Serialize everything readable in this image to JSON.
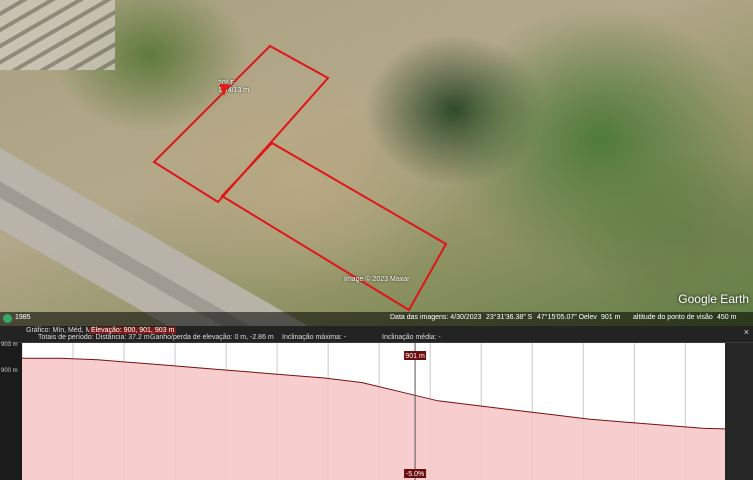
{
  "map": {
    "placemark_label_line1": "20º F",
    "placemark_label_line2": "13/4/13 m",
    "imagery_credit": "Image © 2023 Maxar",
    "logo": "Google Earth",
    "lot_color": "#e01515"
  },
  "status_bar": {
    "year": "1985",
    "imagery_date": "Data das imagens: 4/30/2023",
    "lat": "23°31'36.38\" S",
    "lon": "47°15'05.07\" O",
    "elev_label": "elev",
    "elev_value": "901 m",
    "eye_alt_label": "altitude do ponto de visão",
    "eye_alt_value": "450 m"
  },
  "profile": {
    "header": {
      "graph_label": "Gráfico: Mín, Méd, Máx:",
      "elevation_label": "Elevação: 900, 901, 903 m",
      "range_totals": "Totais de período: Distância: 37.2 m",
      "gain_loss": "Ganho/perda de elevação: 0 m, -2.86 m",
      "max_slope": "Inclinação máxima: -",
      "avg_slope": "Inclinação média: -"
    },
    "cursor_elev": "901 m",
    "cursor_slope": "-5.0%",
    "y_ticks": [
      "903 m",
      "900 m"
    ],
    "fill_color": "#f7c4c4",
    "line_color": "#7a1010"
  },
  "chart_data": {
    "type": "area",
    "x_label": "",
    "y_label": "",
    "ylim": [
      899,
      903.5
    ],
    "x": [
      0,
      2,
      4,
      6,
      8,
      10,
      12,
      14,
      16,
      18,
      20,
      22,
      24,
      26,
      28,
      30,
      32,
      34,
      36,
      37.2
    ],
    "series": [
      {
        "values": [
          903,
          903,
          902.95,
          902.85,
          902.75,
          902.65,
          902.55,
          902.45,
          902.35,
          902.2,
          901.9,
          901.6,
          901.45,
          901.3,
          901.15,
          901.0,
          900.9,
          900.8,
          900.7,
          900.68
        ]
      }
    ],
    "cursor_x": 20.8,
    "gridline_x": [
      0,
      2.7,
      5.4,
      8.1,
      10.8,
      13.5,
      16.2,
      18.9,
      21.6,
      24.3,
      27.0,
      29.7,
      32.4,
      35.1
    ]
  }
}
